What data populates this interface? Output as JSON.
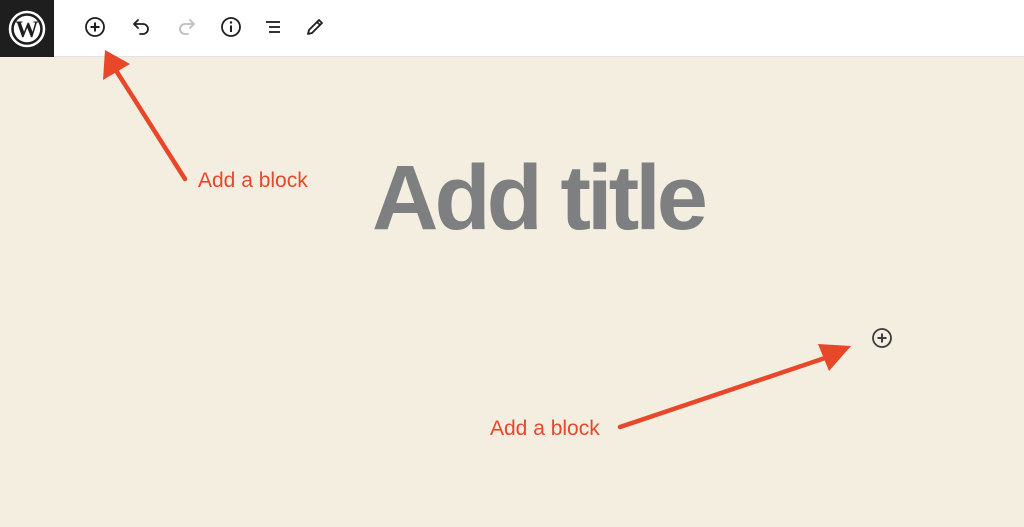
{
  "toolbar": {
    "logo_icon": "wordpress-logo-icon",
    "tools": [
      {
        "name": "add-block-button",
        "icon": "plus-circle-icon"
      },
      {
        "name": "undo-button",
        "icon": "undo-icon"
      },
      {
        "name": "redo-button",
        "icon": "redo-icon"
      },
      {
        "name": "details-button",
        "icon": "info-icon"
      },
      {
        "name": "list-view-button",
        "icon": "list-view-icon"
      },
      {
        "name": "tools-button",
        "icon": "pencil-icon"
      }
    ]
  },
  "editor": {
    "title_placeholder": "Add title",
    "inline_inserter_icon": "plus-circle-icon"
  },
  "annotations": {
    "toolbar_callout": "Add a block",
    "inline_callout": "Add a block",
    "color": "#e8472a"
  },
  "colors": {
    "canvas_background": "#f4eee1",
    "toolbar_background": "#ffffff",
    "logo_background": "#1e1e1e",
    "title_placeholder": "#7d7f80"
  }
}
